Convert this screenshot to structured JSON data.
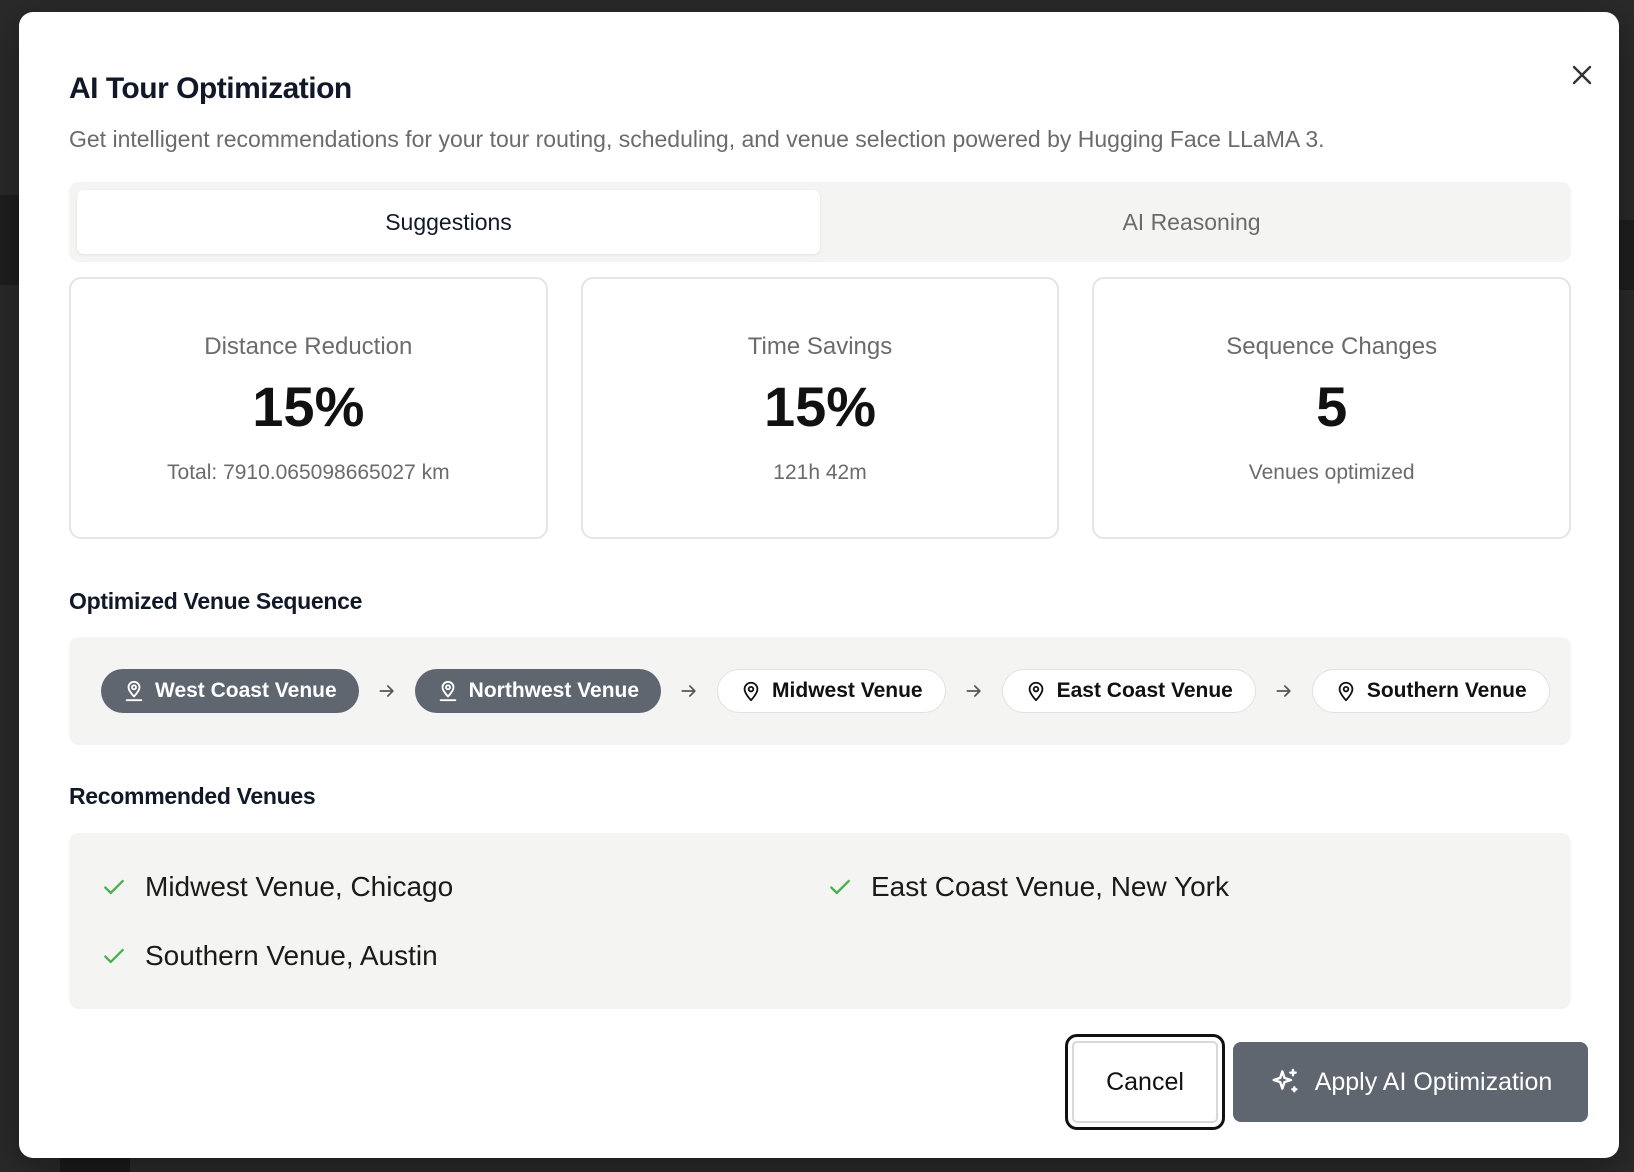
{
  "dialog": {
    "title": "AI Tour Optimization",
    "subtitle": "Get intelligent recommendations for your tour routing, scheduling, and venue selection powered by Hugging Face LLaMA 3."
  },
  "tabs": [
    {
      "label": "Suggestions",
      "active": true
    },
    {
      "label": "AI Reasoning",
      "active": false
    }
  ],
  "stats": [
    {
      "label": "Distance Reduction",
      "value": "15%",
      "sub": "Total: 7910.065098665027 km"
    },
    {
      "label": "Time Savings",
      "value": "15%",
      "sub": "121h 42m"
    },
    {
      "label": "Sequence Changes",
      "value": "5",
      "sub": "Venues optimized"
    }
  ],
  "sequence": {
    "title": "Optimized Venue Sequence",
    "venues": [
      {
        "label": "West Coast Venue",
        "style": "filled",
        "icon": "user-pin-icon"
      },
      {
        "label": "Northwest Venue",
        "style": "filled",
        "icon": "user-pin-icon"
      },
      {
        "label": "Midwest Venue",
        "style": "outlined",
        "icon": "map-pin-icon"
      },
      {
        "label": "East Coast Venue",
        "style": "outlined",
        "icon": "map-pin-icon"
      },
      {
        "label": "Southern Venue",
        "style": "outlined",
        "icon": "map-pin-icon"
      }
    ]
  },
  "recommended": {
    "title": "Recommended Venues",
    "items": [
      "Midwest Venue, Chicago",
      "East Coast Venue, New York",
      "Southern Venue, Austin"
    ]
  },
  "actions": {
    "cancel_label": "Cancel",
    "apply_label": "Apply AI Optimization"
  },
  "colors": {
    "accent": "#5f6670",
    "check": "#4caf50",
    "panel": "#f4f4f3"
  }
}
